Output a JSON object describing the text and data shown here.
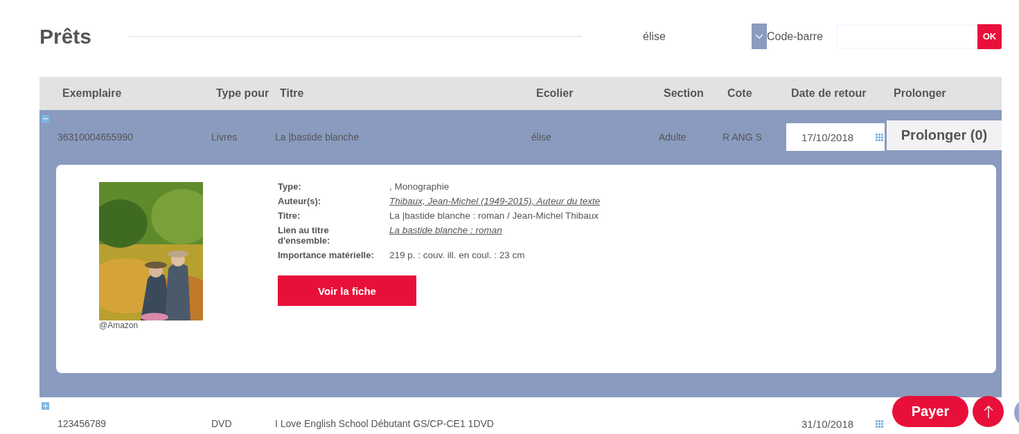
{
  "page": {
    "title": "Prêts"
  },
  "user_select": {
    "value": "élise"
  },
  "barcode": {
    "label": "Code-barre",
    "button": "OK"
  },
  "table": {
    "columns": [
      "Exemplaire",
      "Type pour",
      "Titre",
      "Ecolier",
      "Section",
      "Cote",
      "Date de retour",
      "Prolonger"
    ],
    "rows": [
      {
        "expanded": true,
        "cells": [
          "36310004655990",
          "Livres",
          "La |bastide blanche",
          "élise",
          "Adulte",
          "R ANG S"
        ],
        "date": "17/10/2018",
        "prolong_button": "Prolonger (0)",
        "detail": {
          "image_credit": "@Amazon",
          "fields": [
            {
              "label": "Type:",
              "value": ", Monographie",
              "link": false
            },
            {
              "label": "Auteur(s):",
              "value": "Thibaux, Jean-Michel (1949-2015), Auteur du texte",
              "link": true
            },
            {
              "label": "Titre:",
              "value": "La |bastide blanche : roman / Jean-Michel Thibaux",
              "link": false
            },
            {
              "label": "Lien au titre d'ensemble:",
              "value": "La bastide blanche : roman",
              "link": true
            },
            {
              "label": "Importance matérielle:",
              "value": "219 p. : couv. ill. en coul. : 23 cm",
              "link": false
            }
          ],
          "button": "Voir la fiche"
        }
      },
      {
        "expanded": false,
        "cells": [
          "123456789",
          "DVD",
          "I Love English School Débutant GS/CP-CE1 1DVD"
        ],
        "date": "31/10/2018"
      }
    ]
  },
  "floating": {
    "pay_button": "Payer"
  }
}
